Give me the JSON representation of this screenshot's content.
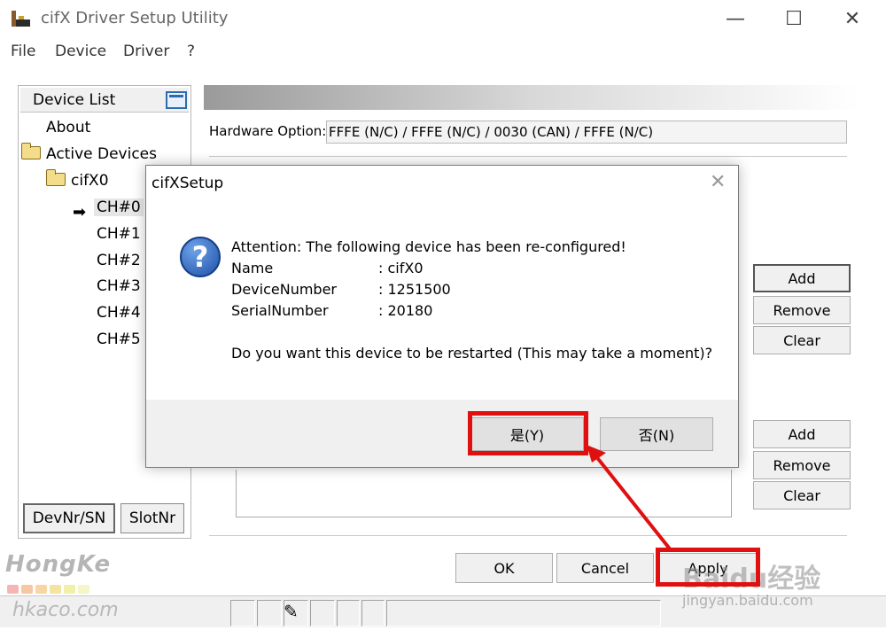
{
  "window": {
    "title": "cifX Driver Setup Utility",
    "minimize": "—",
    "maximize": "☐",
    "close": "✕"
  },
  "menu": [
    "File",
    "Device",
    "Driver",
    "?"
  ],
  "device_list": {
    "title": "Device List",
    "about": "About",
    "active_devices": "Active Devices",
    "device": "cifX0",
    "channels": [
      "CH#0",
      "CH#1",
      "CH#2",
      "CH#3",
      "CH#4",
      "CH#5"
    ],
    "selected_arrow": "➡"
  },
  "bottom_tabs": [
    "DevNr/SN",
    "SlotNr"
  ],
  "hardware": {
    "label": "Hardware Option:",
    "value": "FFFE (N/C) / FFFE (N/C) / 0030 (CAN) / FFFE (N/C)"
  },
  "side_buttons_top": [
    "Add",
    "Remove",
    "Clear"
  ],
  "side_buttons_bottom": [
    "Add",
    "Remove",
    "Clear"
  ],
  "bottom_buttons": [
    "OK",
    "Cancel",
    "Apply"
  ],
  "dialog": {
    "title": "cifXSetup",
    "close": "✕",
    "icon": "?",
    "heading": "Attention: The following device has been re-configured!",
    "fields": [
      {
        "label": "Name",
        "value": ": cifX0"
      },
      {
        "label": "DeviceNumber",
        "value": ": 1251500"
      },
      {
        "label": "SerialNumber",
        "value": ": 20180"
      }
    ],
    "question": "Do you want this device to be restarted (This may take a moment)?",
    "yes": "是(Y)",
    "no": "否(N)"
  },
  "watermarks": {
    "brand": "HongKe",
    "url": "hkaco.com",
    "baidu": "Baidu经验",
    "baidu_url": "jingyan.baidu.com"
  },
  "colors": {
    "annotation_red": "#e01010",
    "question_icon": "#1c4fa8"
  }
}
